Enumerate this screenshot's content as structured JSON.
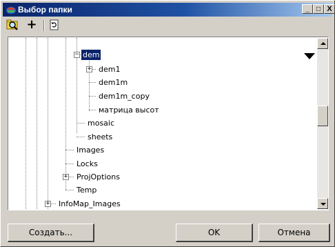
{
  "window": {
    "title": "Выбор папки",
    "minimize_glyph": "_",
    "maximize_glyph": "□",
    "close_glyph": "X"
  },
  "toolbar": {
    "add_glyph": "+",
    "icons": [
      "find-folder-icon",
      "add-icon",
      "refresh-icon"
    ]
  },
  "tree": {
    "items": [
      {
        "label": "dem",
        "selected": true,
        "expand": "−"
      },
      {
        "label": "dem1",
        "expand": "+"
      },
      {
        "label": "dem1m"
      },
      {
        "label": "dem1m_copy"
      },
      {
        "label": "матрица высот"
      },
      {
        "label": "mosaic"
      },
      {
        "label": "sheets"
      },
      {
        "label": "Images"
      },
      {
        "label": "Locks"
      },
      {
        "label": "ProjOptions",
        "expand": "+"
      },
      {
        "label": "Temp"
      },
      {
        "label": "InfoMap_Images",
        "expand": "+"
      }
    ]
  },
  "buttons": {
    "create": "Создать...",
    "ok": "OK",
    "cancel": "Отмена"
  },
  "colors": {
    "selection": "#0a246a",
    "title_start": "#0a246a",
    "title_end": "#a6caf0",
    "face": "#d4d0c8"
  }
}
